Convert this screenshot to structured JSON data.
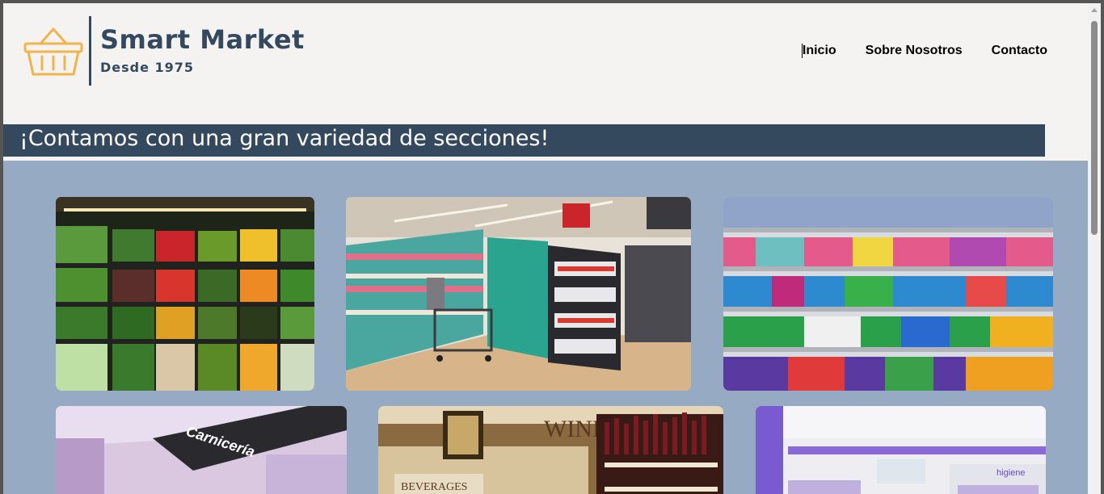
{
  "header": {
    "brand_name": "Smart Market",
    "brand_tagline": "Desde 1975",
    "logo_icon": "basket-icon",
    "nav": [
      {
        "label": "Inicio"
      },
      {
        "label": "Sobre Nosotros"
      },
      {
        "label": "Contacto"
      }
    ]
  },
  "banner": {
    "title": "¡Contamos con una gran variedad de secciones!"
  },
  "gallery": {
    "tiles": [
      {
        "section": "produce"
      },
      {
        "section": "aisle"
      },
      {
        "section": "cleaning"
      },
      {
        "section": "butcher",
        "sign_text": "Carnicería"
      },
      {
        "section": "wine",
        "sign_text": "WINE",
        "sub_sign_text": "BEVERAGES"
      },
      {
        "section": "hygiene",
        "sign_text": "higiene"
      }
    ]
  },
  "colors": {
    "brand": "#34495e",
    "accent": "#f0b44c",
    "gallery_bg": "#96abc3",
    "page_bg": "#f4f3f1"
  }
}
